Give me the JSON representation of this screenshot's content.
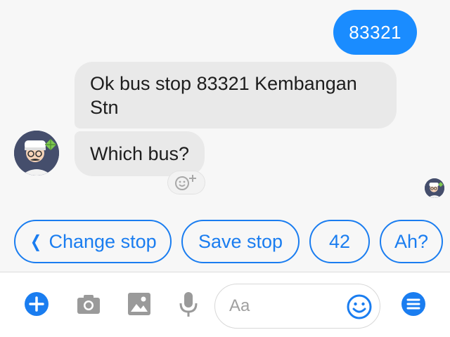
{
  "messages": {
    "outgoing": "83321",
    "incoming_1": "Ok bus stop 83321 Kembangan Stn",
    "incoming_2": "Which bus?"
  },
  "quick_replies": {
    "change_stop": "Change stop",
    "save_stop": "Save stop",
    "bus_42": "42",
    "ah": "Ah?"
  },
  "composer": {
    "placeholder": "Aa",
    "icons": [
      "plus-icon",
      "camera-icon",
      "image-icon",
      "microphone-icon",
      "emoji-icon",
      "menu-icon"
    ]
  },
  "colors": {
    "accent": "#1a8cff",
    "incoming_bubble": "#e9e9e9",
    "icon_gray": "#9a9a9a",
    "avatar_bg": "#454e6c"
  }
}
